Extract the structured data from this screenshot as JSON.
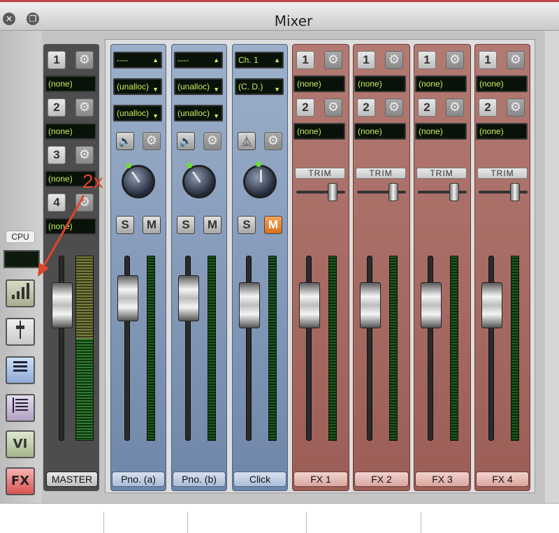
{
  "window": {
    "title": "Mixer"
  },
  "sidebar": {
    "cpu_label": "CPU",
    "buttons": [
      {
        "name": "meter-view-button",
        "icon": "bars-icon"
      },
      {
        "name": "fader-view-button",
        "icon": "fader-icon"
      },
      {
        "name": "list-view-button",
        "icon": "list-icon"
      },
      {
        "name": "list2-view-button",
        "icon": "list2-icon"
      },
      {
        "name": "vi-button",
        "label": "VI"
      },
      {
        "name": "fx-button",
        "label": "FX"
      }
    ]
  },
  "annotation": {
    "text": "2x",
    "color": "#e0442c"
  },
  "master": {
    "sends": [
      {
        "num": "1",
        "value": "(none)"
      },
      {
        "num": "2",
        "value": "(none)"
      },
      {
        "num": "3",
        "value": "(none)"
      },
      {
        "num": "4",
        "value": "(none)"
      }
    ],
    "label": "MASTER"
  },
  "channels": [
    {
      "label": "Pno. (a)",
      "input": "----",
      "out1": "(unalloc)",
      "out2": "(unalloc)",
      "solo": "S",
      "mute": "M"
    },
    {
      "label": "Pno. (b)",
      "input": "----",
      "out1": "(unalloc)",
      "out2": "(unalloc)",
      "solo": "S",
      "mute": "M"
    },
    {
      "label": "Click",
      "input": "Ch. 1",
      "out1": "(C. D.)",
      "solo": "S",
      "mute": "M",
      "mute_active": true
    }
  ],
  "fx": [
    {
      "label": "FX 1",
      "sends": [
        {
          "num": "1",
          "value": "(none)"
        },
        {
          "num": "2",
          "value": "(none)"
        }
      ],
      "trim": "TRIM"
    },
    {
      "label": "FX 2",
      "sends": [
        {
          "num": "1",
          "value": "(none)"
        },
        {
          "num": "2",
          "value": "(none)"
        }
      ],
      "trim": "TRIM"
    },
    {
      "label": "FX 3",
      "sends": [
        {
          "num": "1",
          "value": "(none)"
        },
        {
          "num": "2",
          "value": "(none)"
        }
      ],
      "trim": "TRIM"
    },
    {
      "label": "FX 4",
      "sends": [
        {
          "num": "1",
          "value": "(none)"
        },
        {
          "num": "2",
          "value": "(none)"
        }
      ],
      "trim": "TRIM"
    }
  ],
  "colors": {
    "lcd_text": "#c8f060",
    "mute_active": "#d7701e"
  }
}
